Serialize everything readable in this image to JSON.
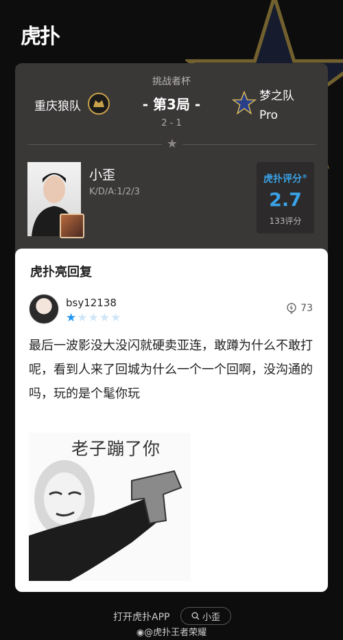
{
  "app": {
    "logo": "虎扑"
  },
  "match": {
    "cup_name": "挑战者杯",
    "round": "- 第3局 -",
    "score": "2 - 1",
    "team_left": {
      "name": "重庆狼队"
    },
    "team_right": {
      "name_line1": "梦之队",
      "name_line2": "Pro"
    }
  },
  "player": {
    "name": "小歪",
    "kda": "K/D/A:1/2/3",
    "rating_label": "虎扑评分",
    "rating_value": "2.7",
    "rating_count": "133评分"
  },
  "reply": {
    "title": "虎扑亮回复",
    "username": "bsy12138",
    "stars": 1,
    "stars_max": 5,
    "likes": "73",
    "comment": "最后一波影没大没闪就硬卖亚连，敢蹲为什么不敢打呢，看到人来了回城为什么一个一个回啊，没沟通的吗，玩的是个髦你玩",
    "meme_caption": "老子蹦了你"
  },
  "footer": {
    "open_app": "打开虎扑APP",
    "search_term": "小歪",
    "weibo": "@虎扑王者荣耀"
  },
  "colors": {
    "accent": "#3aa3e8",
    "star_on": "#2196f3",
    "card_dark": "#3a3737",
    "card_light": "#ffffff"
  }
}
